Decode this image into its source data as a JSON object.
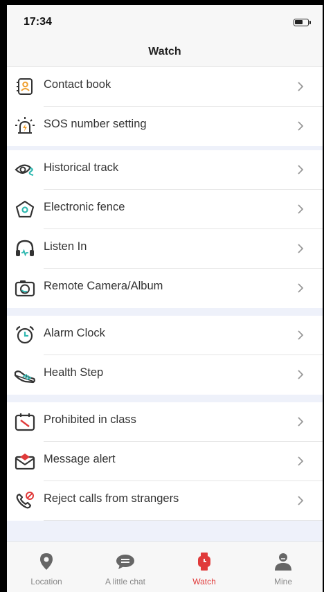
{
  "status_bar": {
    "time": "17:34"
  },
  "header": {
    "title": "Watch"
  },
  "groups": [
    {
      "items": [
        {
          "label": "Contact book",
          "icon": "contact-book-icon"
        },
        {
          "label": "SOS number setting",
          "icon": "sos-alarm-icon"
        }
      ]
    },
    {
      "items": [
        {
          "label": "Historical track",
          "icon": "track-eye-icon"
        },
        {
          "label": "Electronic fence",
          "icon": "fence-pentagon-icon"
        },
        {
          "label": "Listen In",
          "icon": "headphones-icon"
        },
        {
          "label": "Remote Camera/Album",
          "icon": "camera-icon"
        }
      ]
    },
    {
      "items": [
        {
          "label": "Alarm Clock",
          "icon": "alarm-clock-icon"
        },
        {
          "label": "Health Step",
          "icon": "shoe-icon"
        }
      ]
    },
    {
      "items": [
        {
          "label": "Prohibited in class",
          "icon": "calendar-prohibited-icon"
        },
        {
          "label": "Message alert",
          "icon": "envelope-icon"
        },
        {
          "label": "Reject calls from strangers",
          "icon": "phone-block-icon"
        }
      ]
    }
  ],
  "tabs": [
    {
      "label": "Location",
      "icon": "location-pin-icon",
      "active": false
    },
    {
      "label": "A little chat",
      "icon": "chat-bubble-icon",
      "active": false
    },
    {
      "label": "Watch",
      "icon": "watch-icon",
      "active": true
    },
    {
      "label": "Mine",
      "icon": "user-icon",
      "active": false
    }
  ],
  "colors": {
    "accent": "#e03a3a",
    "icon_dark": "#333333",
    "icon_teal": "#2fb8b0",
    "icon_orange": "#f0a030",
    "tab_inactive": "#888888"
  }
}
